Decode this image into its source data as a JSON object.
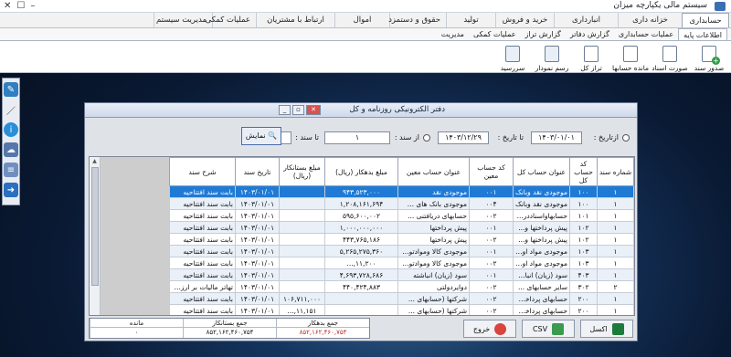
{
  "app": {
    "title": "سیستم مالی یکپارچه میزان"
  },
  "menu": [
    "حسابداری",
    "خزانه داری",
    "انبارداری",
    "خرید و فروش",
    "تولید",
    "حقوق و دستمزد",
    "اموال",
    "ارتباط با مشتریان",
    "عملیات کمکی",
    "مدیریت سیستم"
  ],
  "ribbon": {
    "subtabs": [
      "اطلاعات پایه",
      "عملیات حسابداری",
      "گزارش دفاتر",
      "گزارش تراز",
      "عملیات کمکی",
      "مدیریت"
    ],
    "tools": [
      {
        "label": "صدور سند",
        "icon": "new-document-icon"
      },
      {
        "label": "صورت اسناد",
        "icon": "document-list-icon"
      },
      {
        "label": "مانده حسابها",
        "icon": "balances-icon"
      },
      {
        "label": "تراز کل",
        "icon": "trial-balance-icon"
      },
      {
        "label": "رسم نمودار",
        "icon": "chart-icon"
      },
      {
        "label": "سررسید",
        "icon": "calendar-icon"
      }
    ]
  },
  "dialog": {
    "title": "دفتر الکترونیکی روزنامه و کل",
    "from_date_label": "ازتاریخ :",
    "from_date": "۱۴۰۳/۰۱/۰۱",
    "to_date_label": "تا تاریخ :",
    "to_date": "۱۴۰۳/۱۲/۲۹",
    "from_doc_label": "از سند :",
    "from_doc": "۱",
    "to_doc_label": "تا سند :",
    "to_doc": "۱۲۲۱",
    "show_label": "نمایش",
    "columns": [
      "شماره سند",
      "کد حساب کل",
      "عنوان حساب کل",
      "کد حساب معین",
      "عنوان حساب معین",
      "مبلغ بدهکار (ریال)",
      "مبلغ بستانکار (ریال)",
      "تاریخ سند",
      "شرح سند"
    ],
    "rows": [
      [
        "۱",
        "۱۰۰",
        "موجودی نقد وبانک",
        "۰۰۱",
        "موجودی نقد",
        "۹۴۳,۵۲۳,۰۰۰",
        "",
        "۱۴۰۳/۰۱/۰۱",
        "بابت سند افتتاحیه"
      ],
      [
        "۱",
        "۱۰۰",
        "موجودی نقد وبانک",
        "۰۰۴",
        "موجودی بانک های ...",
        "۱,۲۰۸,۱۶۱,۶۹۴",
        "",
        "۱۴۰۳/۰۱/۰۱",
        "بابت سند افتتاحیه"
      ],
      [
        "۱",
        "۱۰۱",
        "حسابهاواسناددر...",
        "۰۰۲",
        "حسابهای دریافتنی ...",
        "۵۹۵,۶۰۰,۰۰۲",
        "",
        "۱۴۰۳/۰۱/۰۱",
        "بابت سند افتتاحیه"
      ],
      [
        "۱",
        "۱۰۲",
        "پیش پرداختها و...",
        "۰۰۱",
        "پیش پرداختها",
        "۱,۰۰۰,۰۰۰,۰۰۰",
        "",
        "۱۴۰۳/۰۱/۰۱",
        "بابت سند افتتاحیه"
      ],
      [
        "۱",
        "۱۰۲",
        "پیش پرداختها و...",
        "۰۰۲",
        "پیش پرداختها",
        "۴۴۳,۷۶۵,۱۸۶",
        "",
        "۱۴۰۳/۰۱/۰۱",
        "بابت سند افتتاحیه"
      ],
      [
        "۱",
        "۱۰۳",
        "موجودی مواد اولیه...",
        "۰۰۱",
        "موجودی کالا وموادتولیدی",
        "۵,۲۶۵,۲۷۵,۳۶۰",
        "",
        "۱۴۰۳/۰۱/۰۱",
        "بابت سند افتتاحیه"
      ],
      [
        "۱",
        "۱۰۳",
        "موجودی مواد اولیه...",
        "۰۰۲",
        "موجودی کالا وموادتولیدی",
        "۱۱,۲۰۰,...",
        "",
        "۱۴۰۳/۰۱/۰۱",
        "بابت سند افتتاحیه"
      ],
      [
        "۱",
        "۴۰۳",
        "سود (زیان) انباشته",
        "۰۰۱",
        "سود (زیان) انباشته",
        "۴,۶۹۳,۷۲۸,۶۸۶",
        "",
        "۱۴۰۳/۰۱/۰۱",
        "بابت سند افتتاحیه"
      ],
      [
        "۲",
        "۳۰۲",
        "سایر حسابهای ...",
        "۰۰۲",
        "دوایردولتی",
        "۴۴۰,۴۲۴,۸۸۳",
        "",
        "۱۴۰۳/۰۱/۰۱",
        "تهاتر مالیات بر ارزش..."
      ],
      [
        "۱",
        "۲۰۰",
        "حسابهای پرداخت...",
        "۰۰۲",
        "شرکتها (حسابهای ...",
        "",
        "۱۰۶,۷۱۱,۰۰۰",
        "۱۴۰۳/۰۱/۰۱",
        "بابت سند افتتاحیه"
      ],
      [
        "۱",
        "۲۰۰",
        "حسابهای پرداخت...",
        "۰۰۲",
        "شرکتها (حسابهای ...",
        "",
        "۱۱,۱۵۱,...",
        "۱۴۰۳/۰۱/۰۱",
        "بابت سند افتتاحیه"
      ]
    ],
    "totals": {
      "headers": [
        "جمع بدهکار",
        "جمع بستانکار",
        "مانده"
      ],
      "values": [
        "۸۵۲,۱۶۲,۴۶۰,۷۵۴",
        "۸۵۲,۱۶۲,۴۶۰,۷۵۴",
        "۰"
      ]
    },
    "buttons": {
      "excel": "اکسل",
      "csv": "CSV",
      "exit": "خروج"
    }
  },
  "colors": {
    "selected_row": "#1f7ad6",
    "debit_total": "#c0262d"
  }
}
